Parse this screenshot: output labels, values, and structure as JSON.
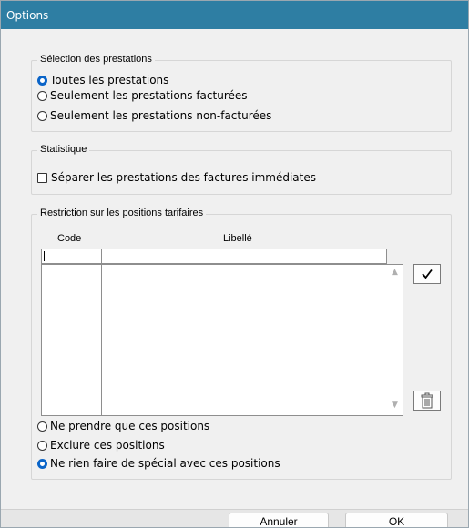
{
  "window": {
    "title": "Options"
  },
  "selection_group": {
    "legend": "Sélection des prestations",
    "options": [
      {
        "label": "Toutes les prestations",
        "selected": true
      },
      {
        "label": "Seulement les prestations facturées",
        "selected": false
      },
      {
        "label": "Seulement les prestations non-facturées",
        "selected": false
      }
    ]
  },
  "statistics_group": {
    "legend": "Statistique",
    "checkbox": {
      "label": "Séparer les prestations des factures immédiates",
      "checked": false
    }
  },
  "restriction_group": {
    "legend": "Restriction sur les positions tarifaires",
    "columns": {
      "code": "Code",
      "label": "Libellé"
    },
    "edit_row": {
      "code": "",
      "label": ""
    },
    "rows": [],
    "confirm_icon": "checkmark-icon",
    "delete_icon": "trash-icon",
    "options": [
      {
        "label": "Ne prendre que ces positions",
        "selected": false
      },
      {
        "label": "Exclure ces positions",
        "selected": false
      },
      {
        "label": "Ne rien faire de spécial avec ces positions",
        "selected": true
      }
    ]
  },
  "footer": {
    "cancel_label": "Annuler",
    "ok_label": "OK"
  },
  "colors": {
    "titlebar": "#2e7ea3",
    "radio_selected": "#0a64c8",
    "background": "#f0f0f0"
  }
}
